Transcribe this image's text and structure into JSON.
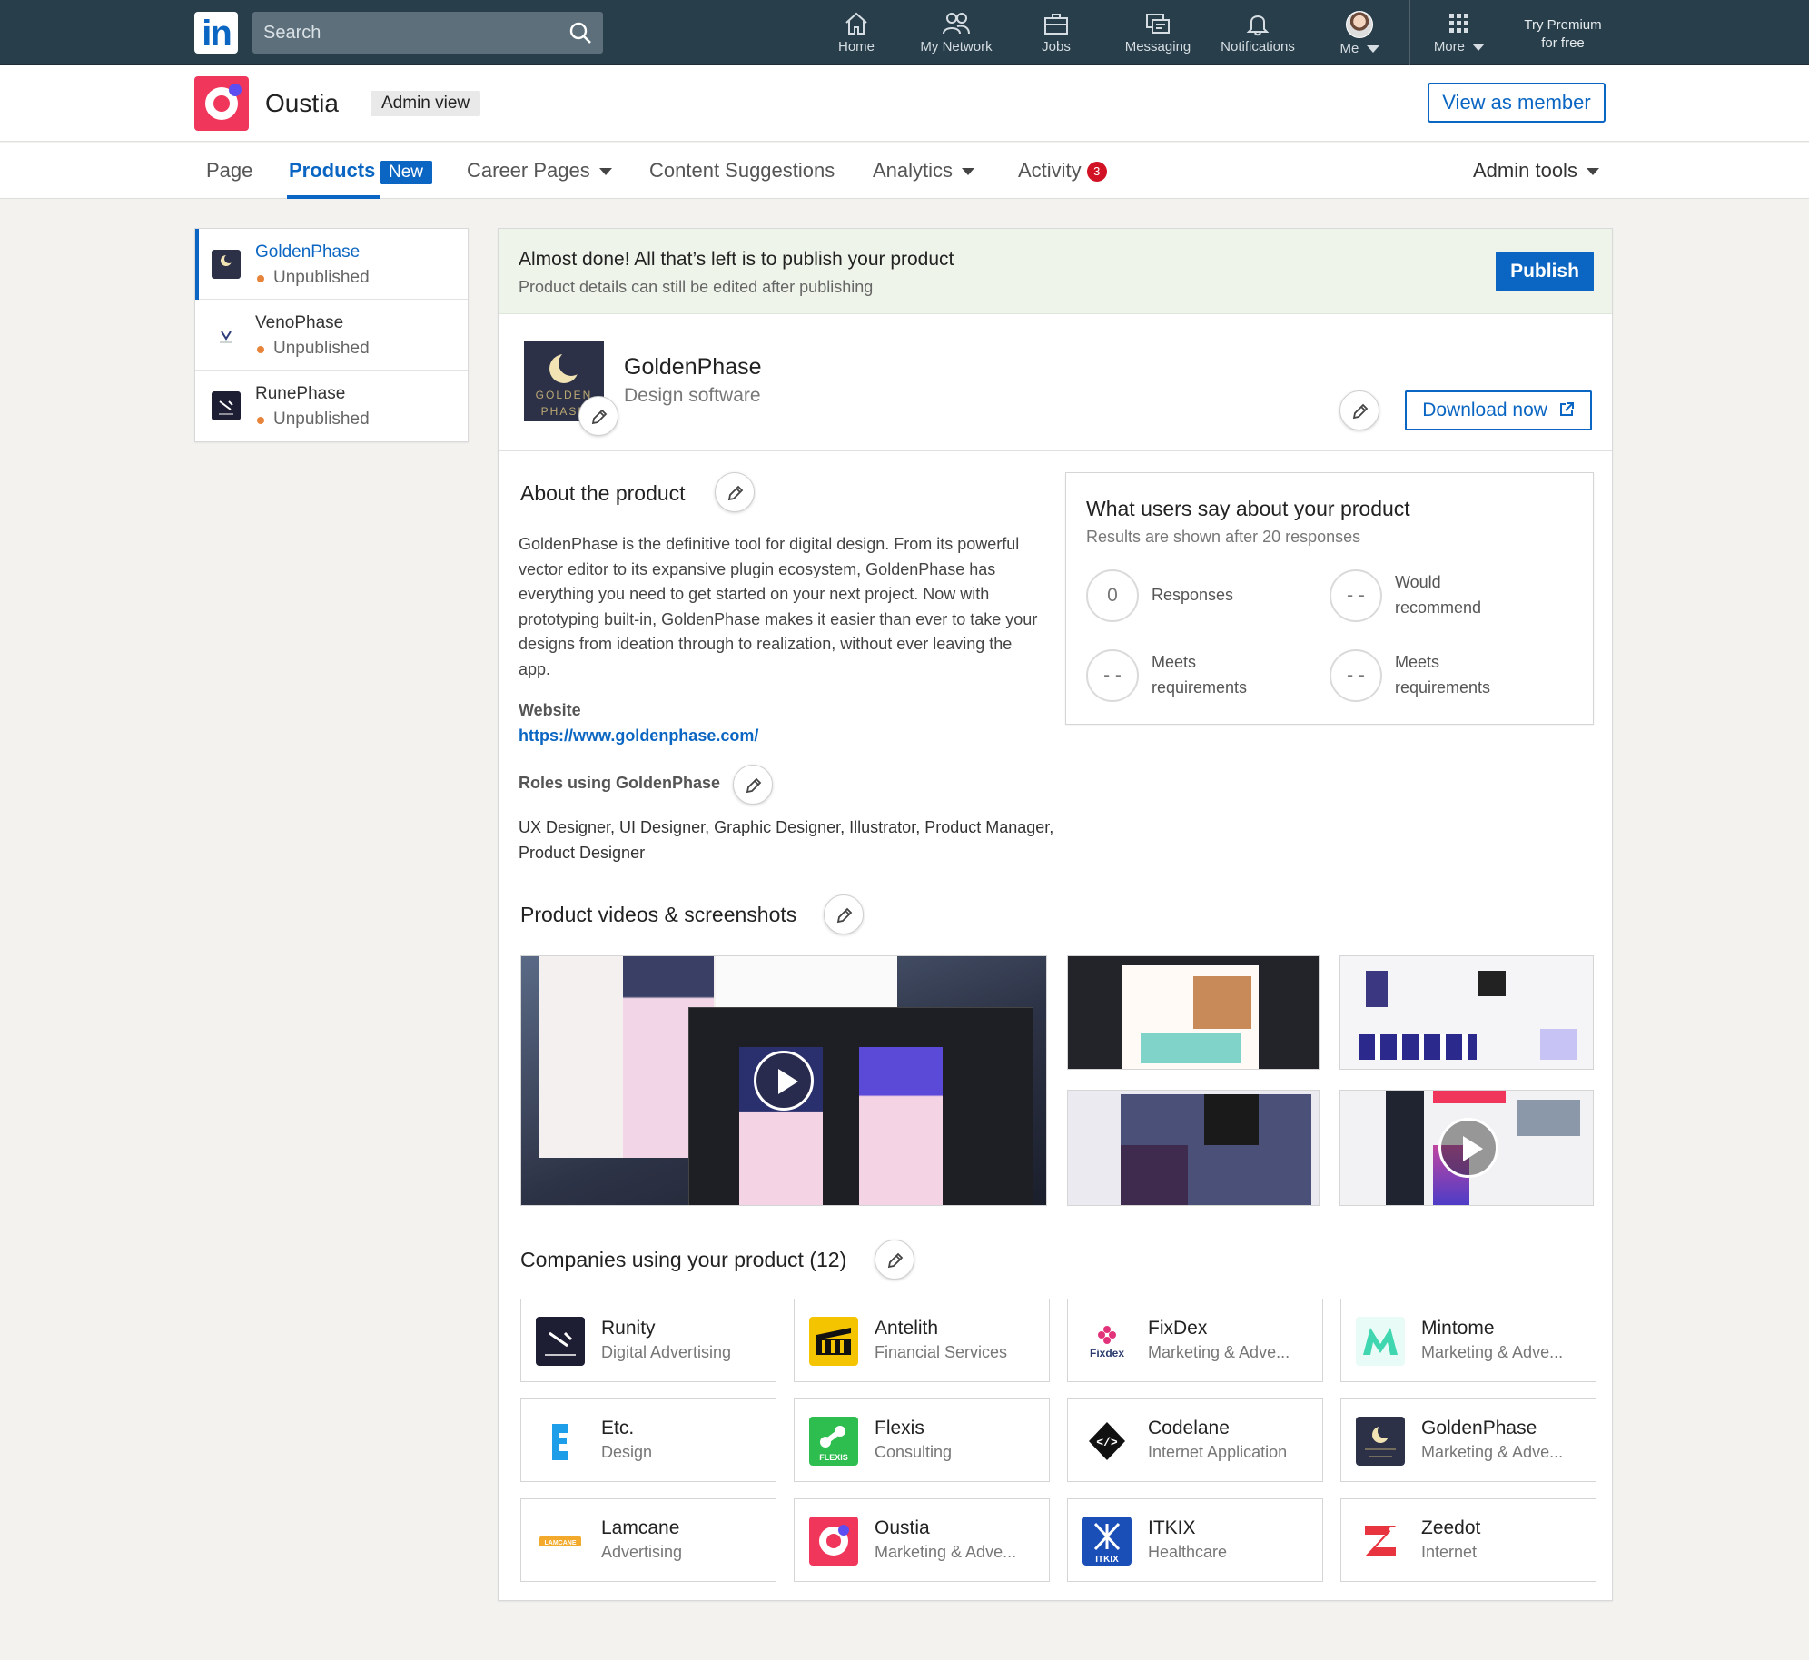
{
  "topnav": {
    "search_placeholder": "Search",
    "items": [
      {
        "label": "Home"
      },
      {
        "label": "My Network"
      },
      {
        "label": "Jobs"
      },
      {
        "label": "Messaging"
      },
      {
        "label": "Notifications"
      },
      {
        "label": "Me"
      },
      {
        "label": "More"
      }
    ],
    "premium_line1": "Try Premium",
    "premium_line2": "for free"
  },
  "company": {
    "name": "Oustia",
    "admin_chip": "Admin view",
    "view_as_member": "View as member"
  },
  "tabs": [
    {
      "label": "Page"
    },
    {
      "label": "Products",
      "badge": "New"
    },
    {
      "label": "Career Pages"
    },
    {
      "label": "Content Suggestions"
    },
    {
      "label": "Analytics"
    },
    {
      "label": "Activity",
      "count": "3"
    },
    {
      "label": "Admin tools"
    }
  ],
  "product_list": [
    {
      "name": "GoldenPhase",
      "status": "Unpublished"
    },
    {
      "name": "VenoPhase",
      "status": "Unpublished"
    },
    {
      "name": "RunePhase",
      "status": "Unpublished"
    }
  ],
  "banner": {
    "title": "Almost done! All that’s left is to publish your product",
    "subtitle": "Product details can still be edited after publishing",
    "publish": "Publish"
  },
  "product": {
    "name": "GoldenPhase",
    "category": "Design software",
    "download": "Download now",
    "logo_text": "GOLDEN PHASE"
  },
  "about": {
    "title": "About the product",
    "text": "GoldenPhase is the definitive tool for digital design. From its powerful vector editor to its expansive plugin ecosystem, GoldenPhase has everything you need to get started on your next project. Now with prototyping built-in, GoldenPhase makes it easier than ever to take your designs from ideation through to realization, without ever leaving the app.",
    "website_label": "Website",
    "website_url": "https://www.goldenphase.com/",
    "roles_label": "Roles using GoldenPhase",
    "roles": "UX Designer, UI Designer, Graphic Designer, Illustrator, Product Manager, Product Designer"
  },
  "users_say": {
    "title": "What users say about your product",
    "subtitle": "Results are shown after 20 responses",
    "metrics": [
      {
        "value": "0",
        "label": "Responses"
      },
      {
        "value": "- -",
        "label": "Would recommend"
      },
      {
        "value": "- -",
        "label": "Meets requirements"
      },
      {
        "value": "- -",
        "label": "Meets requirements"
      }
    ]
  },
  "media": {
    "title": "Product videos & screenshots"
  },
  "companies": {
    "title": "Companies using your product (12)",
    "items": [
      {
        "name": "Runity",
        "industry": "Digital Advertising"
      },
      {
        "name": "Antelith",
        "industry": "Financial Services"
      },
      {
        "name": "FixDex",
        "industry": "Marketing & Adve..."
      },
      {
        "name": "Mintome",
        "industry": "Marketing & Adve..."
      },
      {
        "name": "Etc.",
        "industry": "Design"
      },
      {
        "name": "Flexis",
        "industry": "Consulting"
      },
      {
        "name": "Codelane",
        "industry": "Internet Application"
      },
      {
        "name": "GoldenPhase",
        "industry": "Marketing & Adve..."
      },
      {
        "name": "Lamcane",
        "industry": "Advertising"
      },
      {
        "name": "Oustia",
        "industry": "Marketing & Adve..."
      },
      {
        "name": "ITKIX",
        "industry": "Healthcare"
      },
      {
        "name": "Zeedot",
        "industry": "Internet"
      }
    ]
  },
  "colors": {
    "linkedin_blue": "#0a66c2",
    "nav_bg": "#283e4a",
    "oustia_pink": "#f0365b",
    "status_orange": "#e7843a",
    "badge_red": "#d11124"
  }
}
